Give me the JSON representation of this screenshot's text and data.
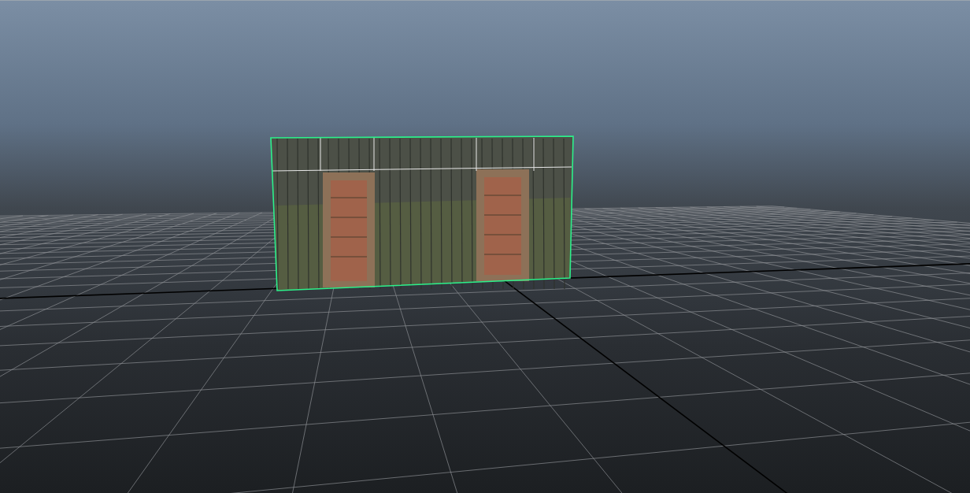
{
  "viewport": {
    "wall": {
      "selected": true
    }
  }
}
